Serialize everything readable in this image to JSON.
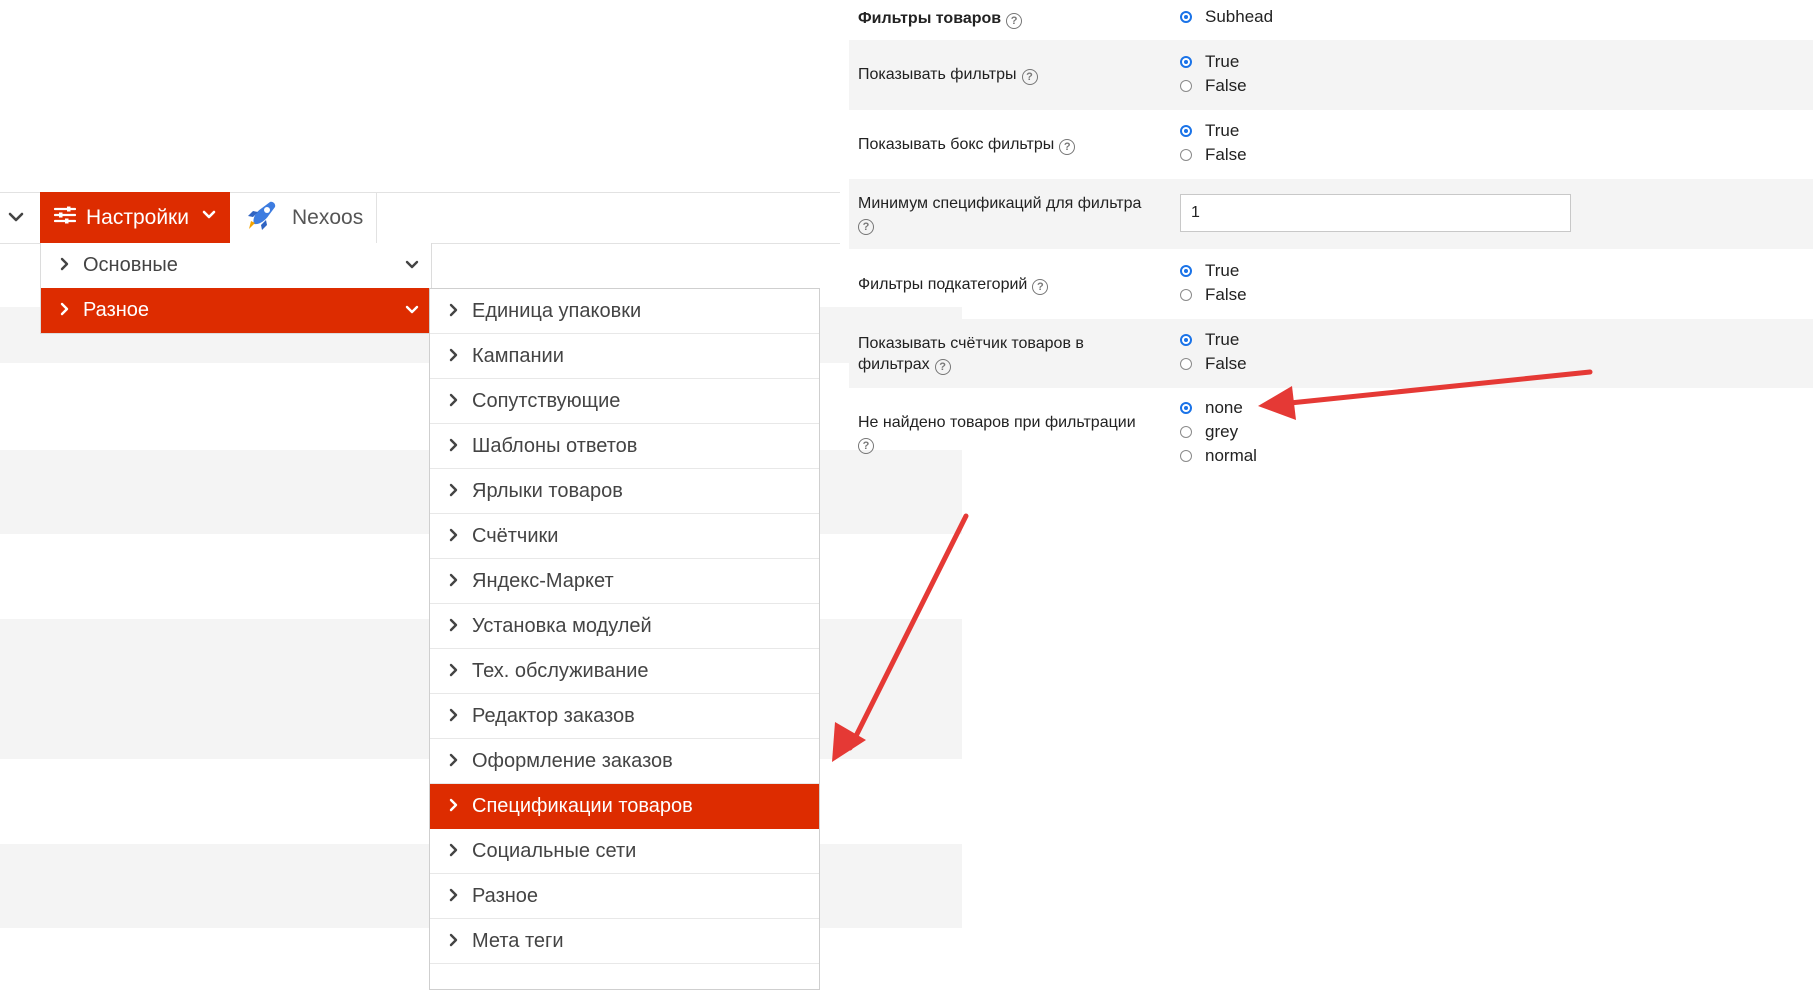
{
  "colors": {
    "accent": "#dd2c00",
    "radio_on": "#1a73e8",
    "arrow": "#e53935",
    "row_alt": "#f4f4f4"
  },
  "topbar": {
    "collapse_icon": "chevron-down-icon",
    "settings": {
      "icon": "sliders-icon",
      "label": "Настройки",
      "dropdown_icon": "chevron-down-icon"
    },
    "nexoos": {
      "icon": "rocket-icon",
      "label": "Nexoos"
    }
  },
  "menu_level1": [
    {
      "label": "Основные",
      "active": false
    },
    {
      "label": "Разное",
      "active": true
    }
  ],
  "menu_level2": [
    {
      "label": "Единица упаковки",
      "active": false
    },
    {
      "label": "Кампании",
      "active": false
    },
    {
      "label": "Сопутствующие",
      "active": false
    },
    {
      "label": "Шаблоны ответов",
      "active": false
    },
    {
      "label": "Ярлыки товаров",
      "active": false
    },
    {
      "label": "Счётчики",
      "active": false
    },
    {
      "label": "Яндекс-Маркет",
      "active": false
    },
    {
      "label": "Установка модулей",
      "active": false
    },
    {
      "label": "Тех. обслуживание",
      "active": false
    },
    {
      "label": "Редактор заказов",
      "active": false
    },
    {
      "label": "Оформление заказов",
      "active": false
    },
    {
      "label": "Спецификации товаров",
      "active": true
    },
    {
      "label": "Социальные сети",
      "active": false
    },
    {
      "label": "Разное",
      "active": false
    },
    {
      "label": "Мета теги",
      "active": false
    }
  ],
  "settings_form": {
    "rows": [
      {
        "label": "Фильтры товаров",
        "options": [
          "Subhead"
        ],
        "selected": "Subhead"
      },
      {
        "label": "Показывать фильтры",
        "options": [
          "True",
          "False"
        ],
        "selected": "True"
      },
      {
        "label": "Показывать бокс фильтры",
        "options": [
          "True",
          "False"
        ],
        "selected": "True"
      },
      {
        "label": "Минимум спецификаций для фильтра",
        "value": "1"
      },
      {
        "label": "Фильтры подкатегорий",
        "options": [
          "True",
          "False"
        ],
        "selected": "True"
      },
      {
        "label_line1": "Показывать счётчик товаров в",
        "label_line2": "фильтрах",
        "options": [
          "True",
          "False"
        ],
        "selected": "True"
      },
      {
        "label": "Не найдено товаров при фильтрации",
        "options": [
          "none",
          "grey",
          "normal"
        ],
        "selected": "none"
      }
    ],
    "help_icon": "question-circle-icon"
  }
}
